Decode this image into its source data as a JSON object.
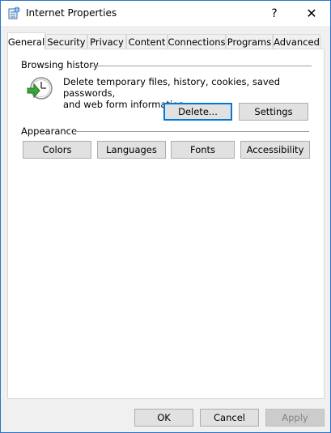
{
  "window": {
    "title": "Internet Properties",
    "help_glyph": "?",
    "close_glyph": "✕"
  },
  "tabs": [
    {
      "label": "General"
    },
    {
      "label": "Security"
    },
    {
      "label": "Privacy"
    },
    {
      "label": "Content"
    },
    {
      "label": "Connections"
    },
    {
      "label": "Programs"
    },
    {
      "label": "Advanced"
    }
  ],
  "browsing_history": {
    "heading": "Browsing history",
    "description_line1": "Delete temporary files, history, cookies, saved passwords,",
    "description_line2": "and web form information.",
    "delete_label": "Delete...",
    "settings_label": "Settings"
  },
  "appearance": {
    "heading": "Appearance",
    "buttons": [
      "Colors",
      "Languages",
      "Fonts",
      "Accessibility"
    ]
  },
  "footer": {
    "ok": "OK",
    "cancel": "Cancel",
    "apply": "Apply"
  }
}
